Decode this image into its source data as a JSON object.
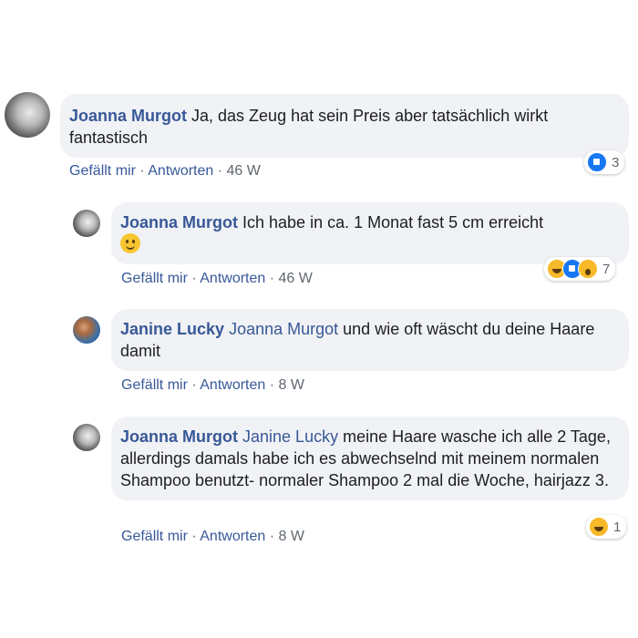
{
  "comments": [
    {
      "author": "Joanna Murgot",
      "mention": "",
      "text": "Ja, das Zeug hat sein Preis aber tatsächlich wirkt fantastisch",
      "like_label": "Gefällt mir",
      "reply_label": "Antworten",
      "time": "46 W",
      "reaction_icons": [
        "like-icon"
      ],
      "reaction_count": "3"
    },
    {
      "author": "Joanna Murgot",
      "mention": "",
      "text": "Ich habe in ca. 1 Monat fast 5 cm erreicht",
      "emoji": "smiling-face-icon",
      "like_label": "Gefällt mir",
      "reply_label": "Antworten",
      "time": "46 W",
      "reaction_icons": [
        "haha-icon",
        "like-icon",
        "wow-icon"
      ],
      "reaction_count": "7"
    },
    {
      "author": "Janine Lucky",
      "mention": "Joanna Murgot",
      "text": "und wie oft wäscht du deine Haare damit",
      "like_label": "Gefällt mir",
      "reply_label": "Antworten",
      "time": "8 W"
    },
    {
      "author": "Joanna Murgot",
      "mention": "Janine Lucky",
      "text": "meine Haare wasche ich alle 2 Tage, allerdings damals habe ich es abwechselnd mit meinem normalen Shampoo benutzt- normaler Shampoo 2 mal die Woche, hairjazz 3.",
      "like_label": "Gefällt mir",
      "reply_label": "Antworten",
      "time": "8 W",
      "reaction_icons": [
        "haha-icon"
      ],
      "reaction_count": "1"
    }
  ],
  "separator": "·",
  "colors": {
    "link": "#385898",
    "bubble": "#f0f2f5",
    "meta": "#606770"
  }
}
